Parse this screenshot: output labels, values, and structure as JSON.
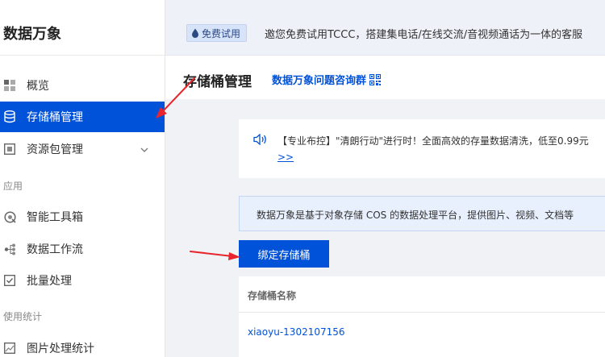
{
  "sidebar": {
    "title": "数据万象",
    "items": [
      {
        "label": "概览",
        "icon": "grid-icon"
      },
      {
        "label": "存储桶管理",
        "icon": "database-icon",
        "active": true
      },
      {
        "label": "资源包管理",
        "icon": "package-icon"
      }
    ],
    "section_app": "应用",
    "app_items": [
      {
        "label": "智能工具箱",
        "icon": "toolbox-icon"
      },
      {
        "label": "数据工作流",
        "icon": "workflow-icon"
      },
      {
        "label": "批量处理",
        "icon": "batch-icon"
      }
    ],
    "section_stats": "使用统计",
    "stats_items": [
      {
        "label": "图片处理统计",
        "icon": "image-stats-icon"
      }
    ]
  },
  "topbar": {
    "trial_tag": "免费试用",
    "banner_text": "邀您免费试用TCCC，搭建集电话/在线交流/音视频通话为一体的客服"
  },
  "header": {
    "title": "存储桶管理",
    "consult_link": "数据万象问题咨询群"
  },
  "notice": {
    "text": "【专业布控】\"清朗行动\"进行时！全面高效的存量数据清洗，低至0.99元",
    "more": ">>"
  },
  "info": {
    "text": "数据万象是基于对象存储 COS 的数据处理平台，提供图片、视频、文档等"
  },
  "actions": {
    "bind_bucket": "绑定存储桶"
  },
  "table": {
    "column_name": "存储桶名称",
    "rows": [
      {
        "name": "xiaoyu-1302107156"
      }
    ]
  },
  "colors": {
    "accent": "#0052d9",
    "annotation": "#e8242c"
  }
}
